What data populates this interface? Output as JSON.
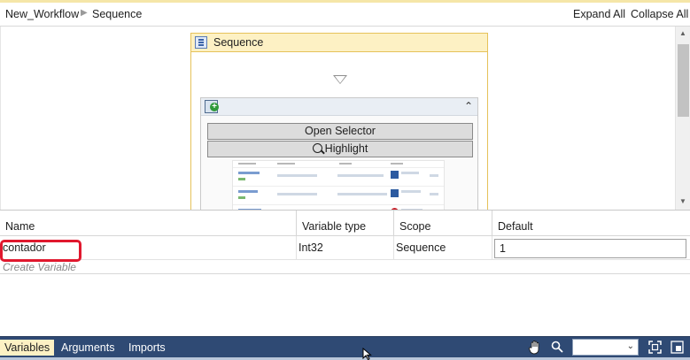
{
  "breadcrumb": {
    "workflow": "New_Workflow",
    "current": "Sequence"
  },
  "toolbar": {
    "expand_all": "Expand All",
    "collapse_all": "Collapse All"
  },
  "designer": {
    "sequence_title": "Sequence",
    "activity": {
      "open_selector": "Open Selector",
      "highlight": "Highlight"
    }
  },
  "variables": {
    "columns": [
      "Name",
      "Variable type",
      "Scope",
      "Default"
    ],
    "rows": [
      {
        "name": "contador",
        "type": "Int32",
        "scope": "Sequence",
        "default": "1"
      }
    ],
    "create_placeholder": "Create Variable"
  },
  "bottom_tabs": [
    {
      "label": "Variables",
      "active": true
    },
    {
      "label": "Arguments",
      "active": false
    },
    {
      "label": "Imports",
      "active": false
    }
  ],
  "zoom": {
    "value": ""
  },
  "colors": {
    "accent_yellow": "#fdf1c4",
    "bottom_bar": "#2f4a74",
    "highlight_red": "#e0182e"
  }
}
